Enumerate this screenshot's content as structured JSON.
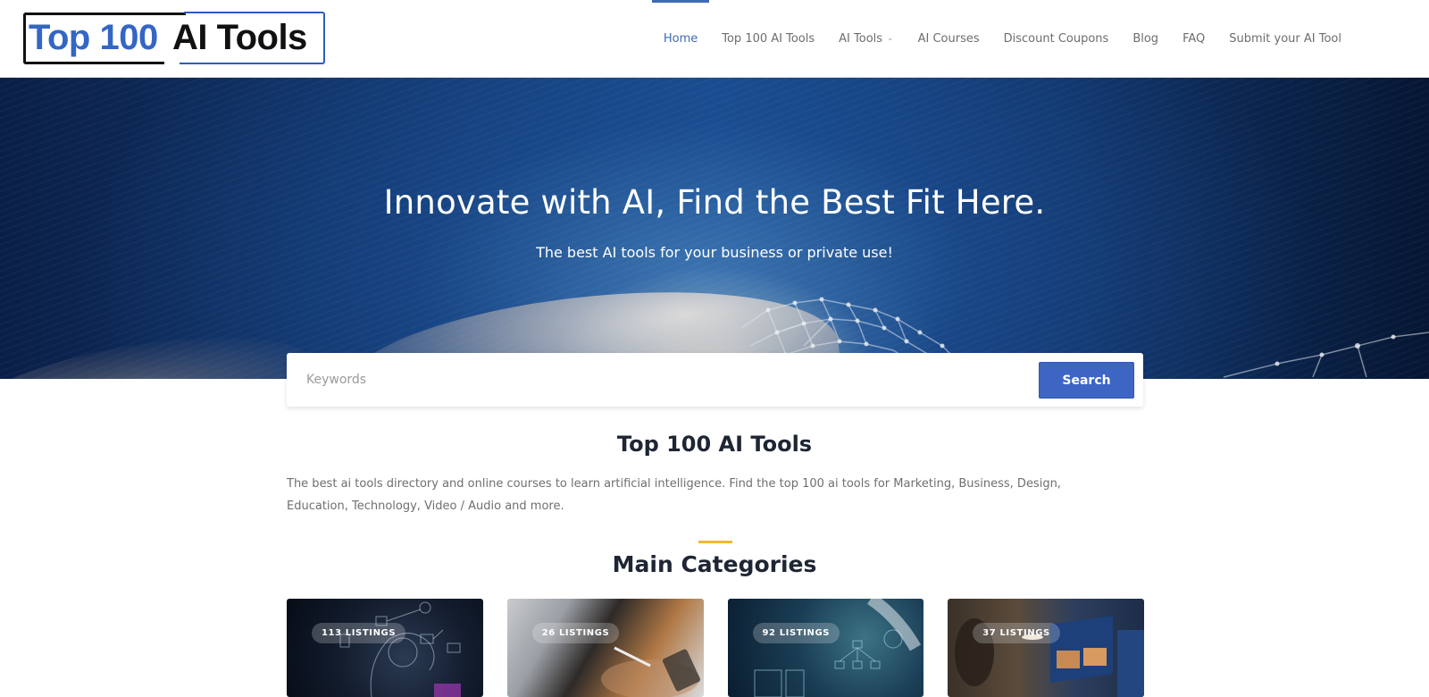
{
  "logo": {
    "part1": "Top 100",
    "part2": "AI Tools"
  },
  "nav": {
    "items": [
      {
        "label": "Home",
        "active": true
      },
      {
        "label": "Top 100 AI Tools"
      },
      {
        "label": "AI Tools",
        "has_dropdown": true
      },
      {
        "label": "AI Courses"
      },
      {
        "label": "Discount Coupons"
      },
      {
        "label": "Blog"
      },
      {
        "label": "FAQ"
      },
      {
        "label": "Submit your AI Tool"
      }
    ],
    "dropdown_icon": "chevron-down-icon",
    "active_color": "#3f6bb4"
  },
  "hero": {
    "title": "Innovate with AI, Find the Best Fit Here.",
    "subtitle": "The best AI tools for your business or private use!"
  },
  "search": {
    "placeholder": "Keywords",
    "value": "",
    "button_label": "Search",
    "button_color": "#3d66c4"
  },
  "intro": {
    "title": "Top 100 AI Tools",
    "text": "The best ai tools directory and online courses to learn artificial intelligence. Find the top 100 ai tools for Marketing, Business, Design, Education, Technology, Video / Audio and more."
  },
  "categories": {
    "divider_color": "#f5b82e",
    "title": "Main Categories",
    "cards": [
      {
        "listings": "113 LISTINGS"
      },
      {
        "listings": "26 LISTINGS"
      },
      {
        "listings": "92 LISTINGS"
      },
      {
        "listings": "37 LISTINGS"
      }
    ]
  }
}
